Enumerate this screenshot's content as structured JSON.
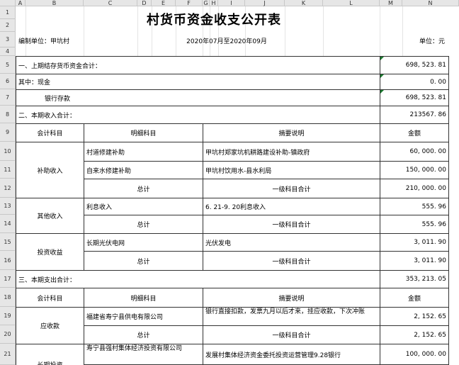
{
  "columns": [
    "A",
    "B",
    "C",
    "D",
    "E",
    "F",
    "G",
    "H",
    "I",
    "J",
    "K",
    "L",
    "M",
    "N"
  ],
  "rows": [
    "1",
    "2",
    "3",
    "4",
    "5",
    "6",
    "7",
    "8",
    "9",
    "10",
    "11",
    "12",
    "13",
    "14",
    "15",
    "16",
    "17",
    "18",
    "19",
    "20",
    "21"
  ],
  "title": "村货币资金收支公开表",
  "meta": {
    "unit_label": "编制单位：甲坑村",
    "period": "2020年07月至2020年09月",
    "currency": "单位：元"
  },
  "section1": {
    "label": "一、上期结存货币资金合计：",
    "amount": "698, 523. 81",
    "cash_label": "其中：现金",
    "cash_amount": "0. 00",
    "bank_label": "银行存款",
    "bank_amount": "698, 523. 81"
  },
  "section2": {
    "label": "二、本期收入合计：",
    "amount": "213567. 86",
    "headers": {
      "account": "会计科目",
      "detail": "明细科目",
      "summary": "摘要说明",
      "amount": "金额"
    },
    "groups": {
      "subsidy": {
        "name": "补助收入",
        "items": [
          {
            "detail": "村道修建补助",
            "summary": "甲坑村郑家坑机耕路建设补助-镇政府",
            "amount": "60, 000. 00"
          },
          {
            "detail": "自来水修建补助",
            "summary": "甲坑村饮用水-县水利局",
            "amount": "150, 000. 00"
          }
        ],
        "total_label": "总计",
        "total_summary": "一级科目合计",
        "total_amount": "210, 000. 00"
      },
      "other": {
        "name": "其他收入",
        "items": [
          {
            "detail": "利息收入",
            "summary": "6. 21-9. 20利息收入",
            "amount": "555. 96"
          }
        ],
        "total_label": "总计",
        "total_summary": "一级科目合计",
        "total_amount": "555. 96"
      },
      "invest": {
        "name": "投资收益",
        "items": [
          {
            "detail": "长期光伏电网",
            "summary": "光伏发电",
            "amount": "3, 011. 90"
          }
        ],
        "total_label": "总计",
        "total_summary": "一级科目合计",
        "total_amount": "3, 011. 90"
      }
    }
  },
  "section3": {
    "label": "三、本期支出合计：",
    "amount": "353, 213. 05",
    "headers": {
      "account": "会计科目",
      "detail": "明细科目",
      "summary": "摘要说明",
      "amount": "金额"
    },
    "groups": {
      "receivable": {
        "name": "应收款",
        "items": [
          {
            "detail": "福建省寿宁县供电有限公司",
            "summary": "银行直接扣款，发票九月以后才来，挂应收款，下次冲账",
            "amount": "2, 152. 65"
          }
        ],
        "total_label": "总计",
        "total_summary": "一级科目合计",
        "total_amount": "2, 152. 65"
      },
      "longterm": {
        "name": "长期投资",
        "items": [
          {
            "detail": "寿宁县强村集体经济投资有限公司",
            "summary": "发展村集体经济资金委托投资运营管理9.28银行",
            "amount": "100, 000. 00"
          }
        ]
      }
    }
  }
}
